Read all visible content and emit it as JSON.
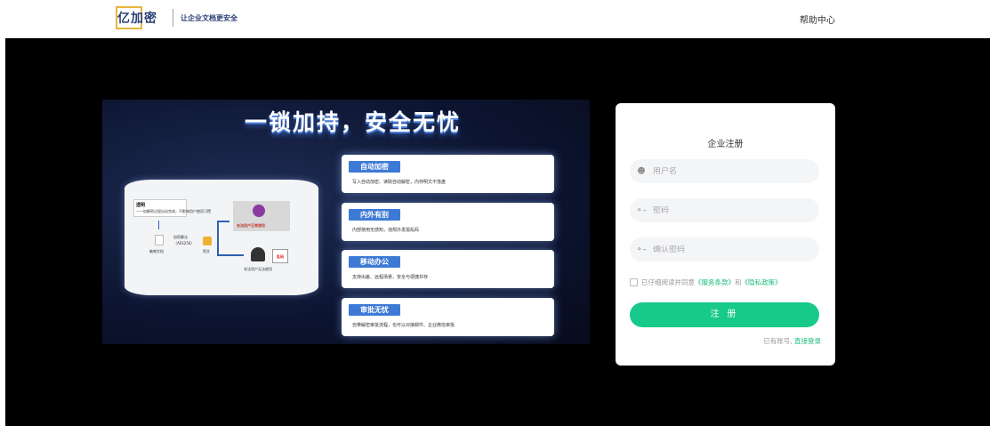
{
  "header": {
    "logo_text": "亿加密",
    "slogan": "让企业文档更安全",
    "help_label": "帮助中心"
  },
  "banner": {
    "title": "一锁加持，安全无忧",
    "diagram": {
      "note_title": "透明",
      "note_text": "——加解密过程自动完成，不影响用户使用习惯",
      "algo": "加密算法",
      "algo_name": "（AES256）",
      "doc_plain": "敏感文档",
      "doc_cipher": "密文",
      "legit_user": "合法用户正常使用",
      "illegal_user": "非法用户无法使用",
      "garbled": "乱码"
    },
    "features": [
      {
        "tag": "自动加密",
        "desc": "写入自动加密、读取自动解密，内存明文不落盘"
      },
      {
        "tag": "内外有别",
        "desc": "内部使用无感知，违规外发需乱码"
      },
      {
        "tag": "移动办公",
        "desc": "支持出差、远程场景，安全与便捷并存"
      },
      {
        "tag": "审批无忧",
        "desc": "自带解密审批流程，也可以对接邮件、企业微信审批"
      }
    ]
  },
  "register": {
    "title": "企业注册",
    "username_placeholder": "用户名",
    "password_placeholder": "密码",
    "confirm_placeholder": "确认密码",
    "agree_prefix": "已仔细阅读并同意",
    "terms_link": "《服务条款》",
    "and": "和",
    "privacy_link": "《隐私政策》",
    "submit_label": "注 册",
    "has_account": "已有账号,",
    "login_link": "直接登录"
  },
  "icons": {
    "user": "user-icon",
    "key": "key-icon",
    "checkbox": "checkbox-icon"
  },
  "colors": {
    "accent": "#17c98a",
    "link": "#1dbb7c",
    "feature_tag": "#3d7ad6",
    "background": "#000000"
  }
}
